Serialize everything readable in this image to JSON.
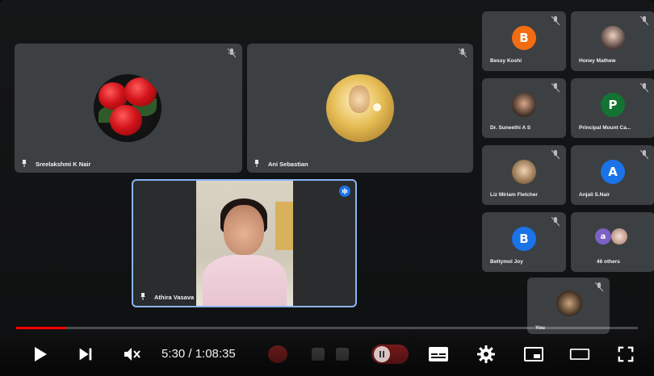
{
  "tiles": {
    "sreelakshmi": {
      "name": "Sreelakshmi K Nair"
    },
    "ani": {
      "name": "Ani Sebastian"
    },
    "athira": {
      "name": "Athira Vasava"
    }
  },
  "grid": [
    {
      "name": "Bessy Koshi",
      "initial": "B",
      "color": "#f36c12"
    },
    {
      "name": "Honey Mathew"
    },
    {
      "name": "Dr. Suneethi A S"
    },
    {
      "name": "Principal Mount Ca...",
      "initial": "P",
      "color": "#137333"
    },
    {
      "name": "Liz Miriam Fletcher"
    },
    {
      "name": "Anjali S.Nair",
      "initial": "A",
      "color": "#1a73e8"
    },
    {
      "name": "Bettymol Joy",
      "initial": "B",
      "color": "#1a73e8"
    },
    {
      "name": "46 others",
      "initial": "a",
      "color": "#7b61c4"
    },
    {
      "name": "You"
    }
  ],
  "player": {
    "time": "5:30 / 1:08:35",
    "progress_pct": 8.0,
    "accent": "#ff0000"
  }
}
